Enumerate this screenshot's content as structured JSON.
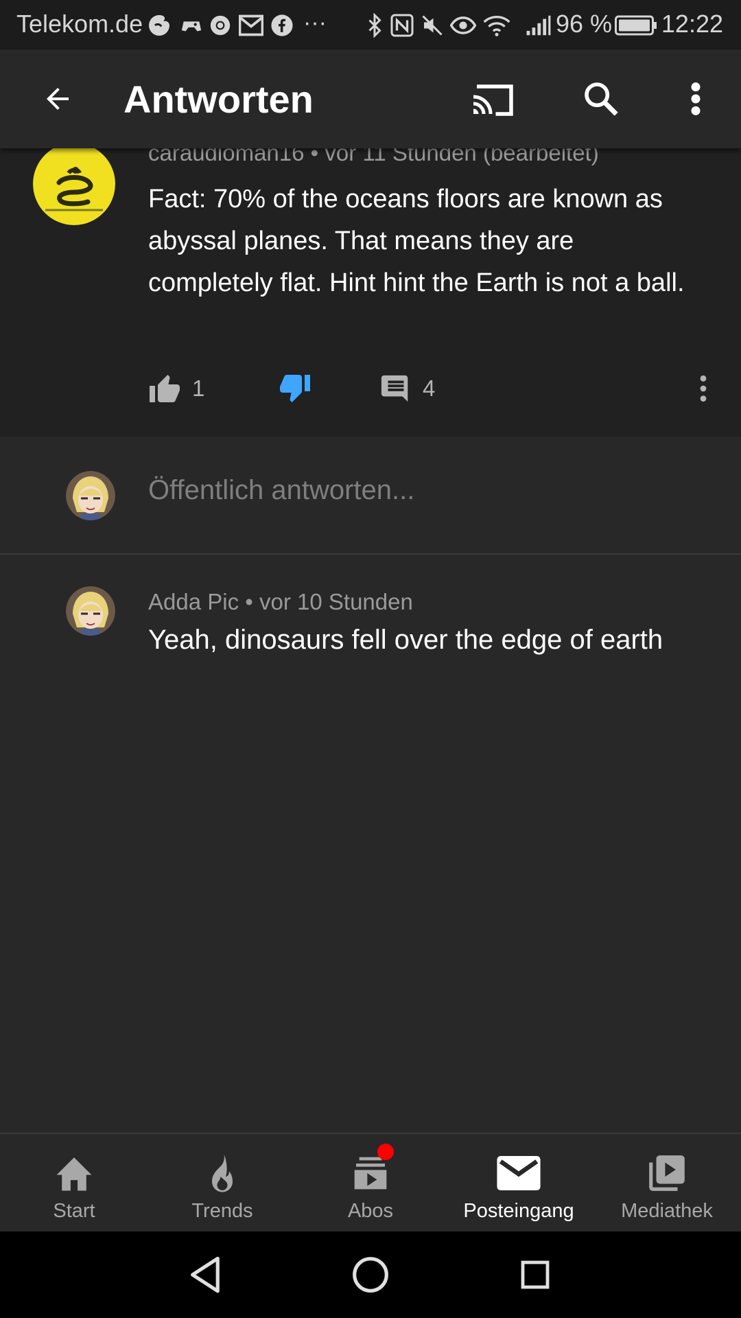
{
  "status_bar": {
    "carrier": "Telekom.de",
    "overflow_indicator": "···",
    "battery_percent": "96 %",
    "time": "12:22",
    "left_icons": [
      "swirl-icon",
      "game-icon",
      "chrome-icon",
      "gmail-icon",
      "facebook-icon"
    ],
    "right_icons": [
      "bluetooth-icon",
      "nfc-icon",
      "mute-icon",
      "eye-icon",
      "wifi-icon",
      "signal-icon",
      "battery-icon"
    ]
  },
  "appbar": {
    "title": "Antworten",
    "icons": [
      "back-arrow-icon",
      "cast-icon",
      "search-icon",
      "more-vert-icon"
    ]
  },
  "main_comment": {
    "author": "caraudioman16",
    "separator": "•",
    "time": "vor 11 Stunden (bearbeitet)",
    "text": "Fact: 70% of the oceans floors are known as abyssal planes. That means they are completely flat. Hint hint the Earth is not a ball.",
    "likes": "1",
    "replies": "4",
    "dislike_active": true
  },
  "composer": {
    "placeholder": "Öffentlich antworten..."
  },
  "reply": {
    "author": "Adda Pic",
    "separator": "•",
    "time": "vor 10 Stunden",
    "text": "Yeah, dinosaurs fell over the edge of earth"
  },
  "bottom_nav": {
    "items": [
      {
        "label": "Start",
        "icon": "home-icon"
      },
      {
        "label": "Trends",
        "icon": "flame-icon"
      },
      {
        "label": "Abos",
        "icon": "subscriptions-icon"
      },
      {
        "label": "Posteingang",
        "icon": "mail-icon"
      },
      {
        "label": "Mediathek",
        "icon": "library-icon"
      }
    ],
    "active_index": 3
  },
  "colors": {
    "background": "#282828",
    "comment_background": "#212121",
    "dislike_active": "#3ea6ff",
    "badge": "#ff0000",
    "avatar_yellow": "#f0e020"
  }
}
